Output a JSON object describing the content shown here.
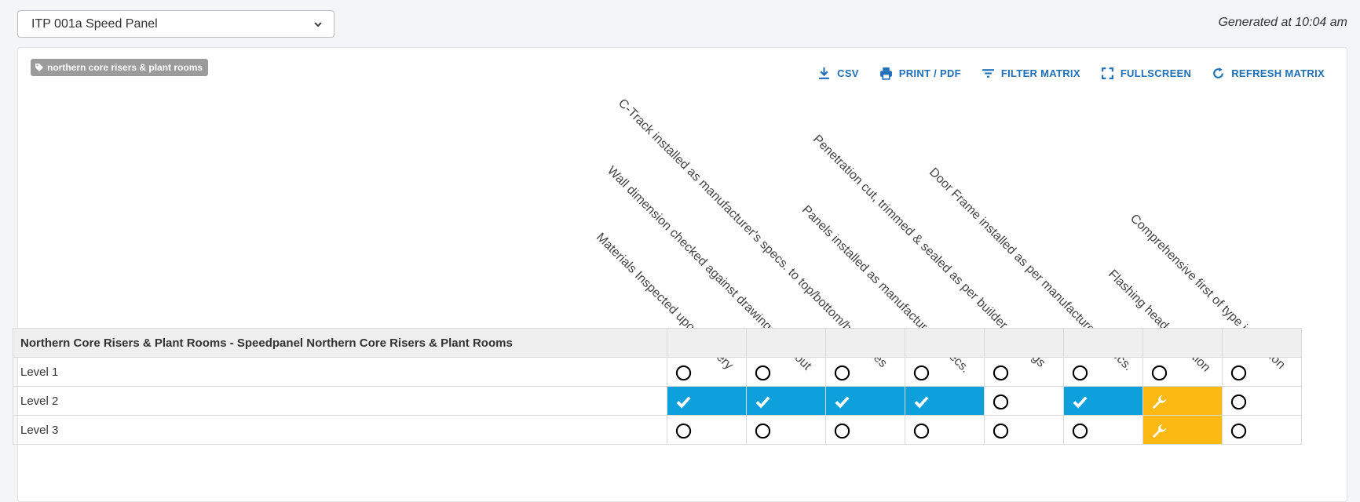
{
  "itp_select": {
    "selected": "ITP 001a Speed Panel"
  },
  "generated_text": "Generated at 10:04 am",
  "tag": {
    "label": "northern core risers & plant rooms"
  },
  "toolbar": {
    "csv": "CSV",
    "print": "PRINT / PDF",
    "filter": "FILTER MATRIX",
    "fullscreen": "FULLSCREEN",
    "refresh": "REFRESH MATRIX"
  },
  "columns": [
    "Materials Inspected upon delivery",
    "Wall dimension checked against drawings & setout",
    "C-Track installed as manufacturer's specs. to top/bottom/both sides",
    "Panels installed as manufacturer's specs.",
    "Penetration cut, trimmed & sealed as per builder drawings",
    "Door Frame installed as per manufacturer's specs.",
    "Flashing head-protection",
    "Comprehensive first of type inspection"
  ],
  "group_title": "Northern Core Risers & Plant Rooms - Speedpanel Northern Core Risers & Plant Rooms",
  "rows": [
    {
      "label": "Level 1",
      "cells": [
        "open",
        "open",
        "open",
        "open",
        "open",
        "open",
        "open",
        "open"
      ]
    },
    {
      "label": "Level 2",
      "cells": [
        "done",
        "done",
        "done",
        "done",
        "open",
        "done",
        "work",
        "open"
      ]
    },
    {
      "label": "Level 3",
      "cells": [
        "open",
        "open",
        "open",
        "open",
        "open",
        "open",
        "work",
        "open"
      ]
    }
  ],
  "colors": {
    "done": "#0ea0dc",
    "work": "#fdb913",
    "accent": "#1f6fb8",
    "tag": "#9b9b9b"
  }
}
